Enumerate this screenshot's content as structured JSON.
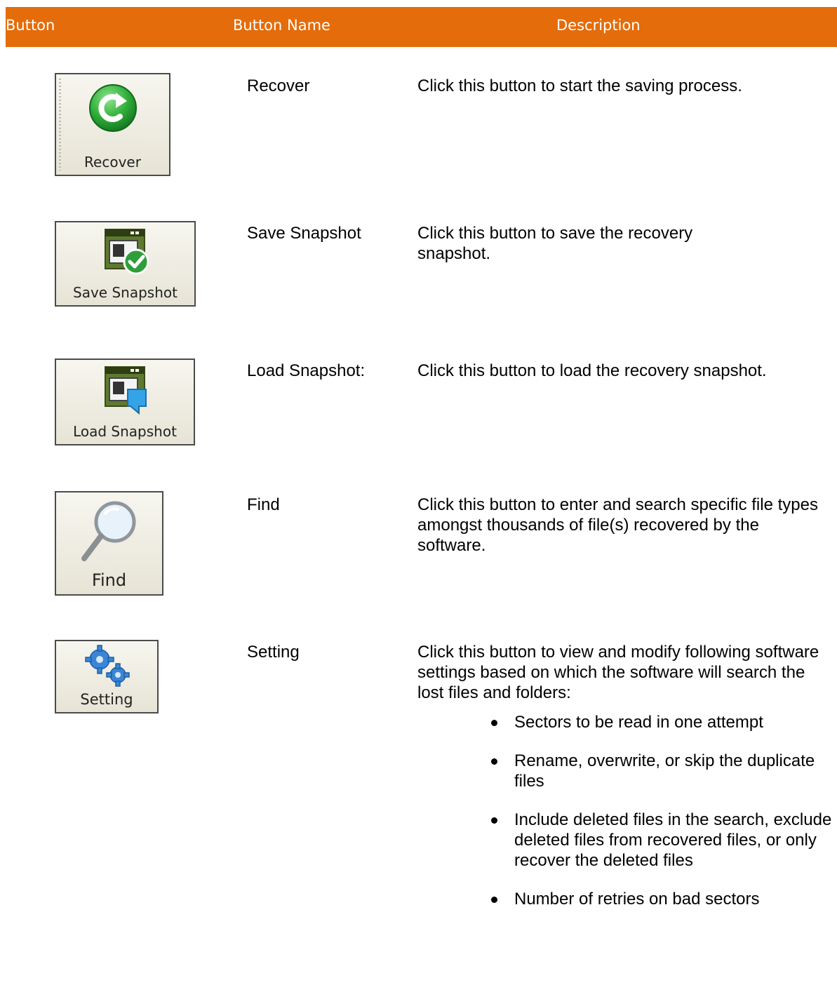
{
  "header": {
    "col_button": "Button",
    "col_name": "Button Name",
    "col_description": "Description"
  },
  "rows": [
    {
      "icon_label": "Recover",
      "icon": "recover-icon",
      "name": "Recover",
      "description": "Click this button to start the saving process."
    },
    {
      "icon_label": "Save Snapshot",
      "icon": "save-snapshot-icon",
      "name": "Save Snapshot",
      "description": "Click this button to save the recovery snapshot."
    },
    {
      "icon_label": "Load Snapshot",
      "icon": "load-snapshot-icon",
      "name": "Load Snapshot:",
      "description": "Click this button to load the recovery snapshot."
    },
    {
      "icon_label": "Find",
      "icon": "magnifier-icon",
      "name": "Find",
      "description": "Click this button to enter and search specific file types amongst thousands of file(s) recovered by the software."
    },
    {
      "icon_label": "Setting",
      "icon": "gears-icon",
      "name": "Setting",
      "description": "Click this button to view and modify following software settings based on which the software will search the lost files and folders:"
    }
  ],
  "setting_bullets": [
    "Sectors to be read in one attempt",
    "Rename, overwrite, or skip the duplicate files",
    "Include deleted files in the search, exclude deleted files from recovered files, or only recover the deleted files",
    "Number of retries on bad sectors"
  ],
  "colors": {
    "header_bg": "#e46c0a",
    "header_text": "#ffffff"
  }
}
